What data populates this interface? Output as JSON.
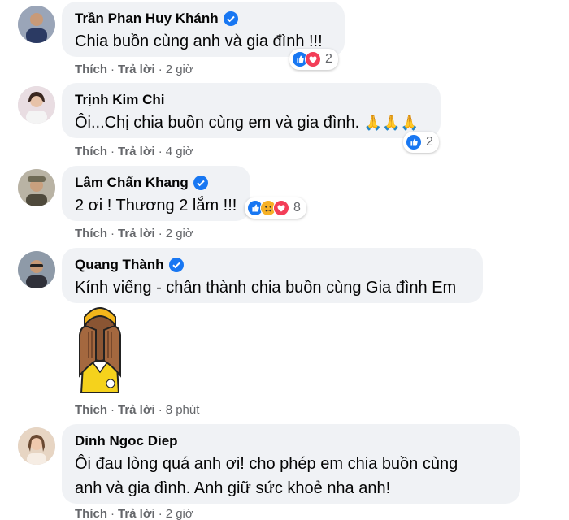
{
  "comments": [
    {
      "name": "Trần Phan Huy Khánh",
      "verified": true,
      "text": "Chia buồn cùng anh và gia đình !!!",
      "like_label": "Thích",
      "reply_label": "Trả lời",
      "time": "2 giờ",
      "reactions": [
        "like",
        "love"
      ],
      "reaction_count": "2"
    },
    {
      "name": "Trịnh Kim Chi",
      "verified": false,
      "text": "Ôi...Chị chia buồn cùng em và gia đình.",
      "text_emoji": "🙏🙏🙏",
      "like_label": "Thích",
      "reply_label": "Trả lời",
      "time": "4 giờ",
      "reactions": [
        "like"
      ],
      "reaction_count": "2"
    },
    {
      "name": "Lâm Chấn Khang",
      "verified": true,
      "text": "2 ơi ! Thương 2 lắm !!!",
      "like_label": "Thích",
      "reply_label": "Trả lời",
      "time": "2 giờ",
      "reactions": [
        "like",
        "sad",
        "love"
      ],
      "reaction_count": "8"
    },
    {
      "name": "Quang Thành",
      "verified": true,
      "text": "Kính viếng - chân thành chia buồn cùng Gia đình Em",
      "sticker": "crying-sticker",
      "like_label": "Thích",
      "reply_label": "Trả lời",
      "time": "8 phút"
    },
    {
      "name": "Dinh Ngoc Diep",
      "verified": false,
      "text_line1": "Ôi đau lòng quá anh ơi! cho phép em chia buồn cùng",
      "text_line2": "anh và gia đình. Anh giữ sức khoẻ nha anh!",
      "like_label": "Thích",
      "reply_label": "Trả lời",
      "time": "2 giờ"
    }
  ],
  "colors": {
    "bubble": "#f0f2f5",
    "secondary_text": "#65676b",
    "like_blue": "#1877f2",
    "love_red": "#f33e58",
    "sad_yellow": "#f7b125"
  },
  "icons": [
    "verified-badge-icon",
    "like-reaction-icon",
    "love-reaction-icon",
    "sad-reaction-icon"
  ]
}
